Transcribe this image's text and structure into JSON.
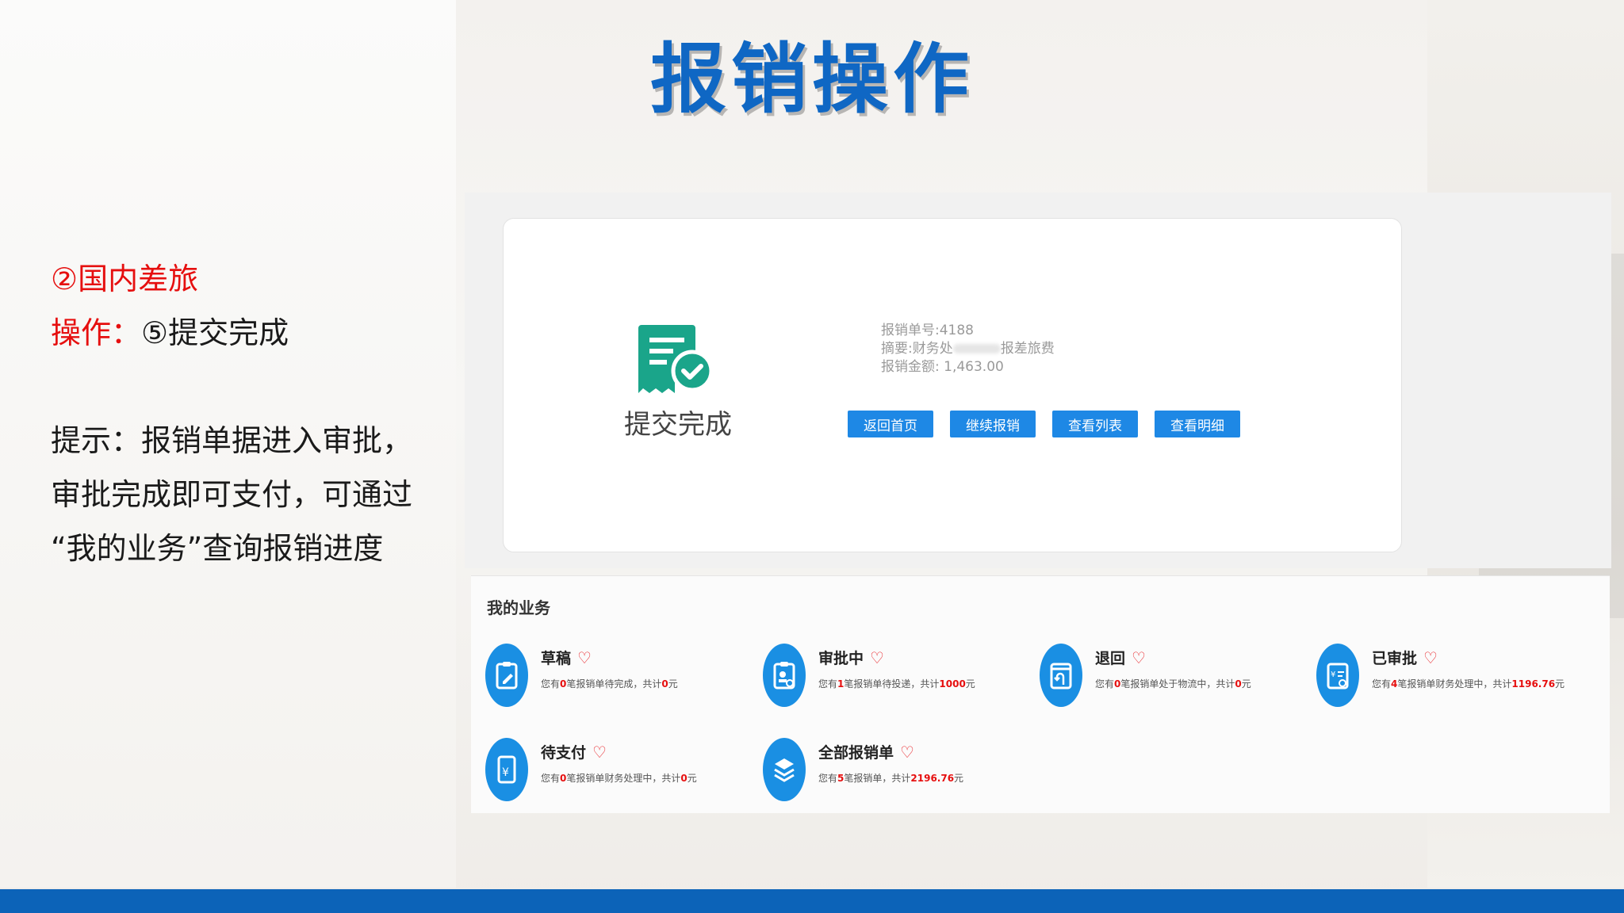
{
  "title": "报销操作",
  "notes": {
    "section": "②国内差旅",
    "operation_label": "操作：",
    "operation_value": "⑤提交完成",
    "tip_line1": "提示：报销单据进入审批，",
    "tip_line2": "审批完成即可支付，可通过",
    "tip_line3": "“我的业务”查询报销进度"
  },
  "submit_card": {
    "status_label": "提交完成",
    "icon": "receipt-check-icon",
    "no_label": "报销单号:4188",
    "summary_prefix": "摘要:财务处",
    "summary_suffix": "报差旅费",
    "amount_label": "报销金额: 1,463.00",
    "buttons": {
      "home": "返回首页",
      "continue": "继续报销",
      "list": "查看列表",
      "detail": "查看明细"
    }
  },
  "my_business": {
    "title": "我的业务",
    "items": [
      {
        "name": "草稿",
        "desc_pre": "您有",
        "count": "0",
        "desc_mid": "笔报销单待完成，共计",
        "total": "0",
        "desc_post": "元",
        "icon": "draft-icon"
      },
      {
        "name": "审批中",
        "desc_pre": "您有",
        "count": "1",
        "desc_mid": "笔报销单待投递，共计",
        "total": "1000",
        "desc_post": "元",
        "icon": "approving-icon"
      },
      {
        "name": "退回",
        "desc_pre": "您有",
        "count": "0",
        "desc_mid": "笔报销单处于物流中，共计",
        "total": "0",
        "desc_post": "元",
        "icon": "returned-icon"
      },
      {
        "name": "已审批",
        "desc_pre": "您有",
        "count": "4",
        "desc_mid": "笔报销单财务处理中，共计",
        "total": "1196.76",
        "desc_post": "元",
        "icon": "approved-icon"
      },
      {
        "name": "待支付",
        "desc_pre": "您有",
        "count": "0",
        "desc_mid": "笔报销单财务处理中，共计",
        "total": "0",
        "desc_post": "元",
        "icon": "pending-payment-icon"
      },
      {
        "name": "全部报销单",
        "desc_pre": "您有",
        "count": "5",
        "desc_mid": "笔报销单，共计",
        "total": "2196.76",
        "desc_post": "元",
        "icon": "all-layers-icon"
      }
    ],
    "heart_icon": "heart-outline-icon"
  },
  "colors": {
    "title_blue": "#0f67c4",
    "accent_red": "#e60f0f",
    "button_blue": "#1e88e5",
    "icon_blue": "#1a8fe3",
    "success_green": "#1aa58a",
    "bottom_bar": "#0c63b8"
  }
}
